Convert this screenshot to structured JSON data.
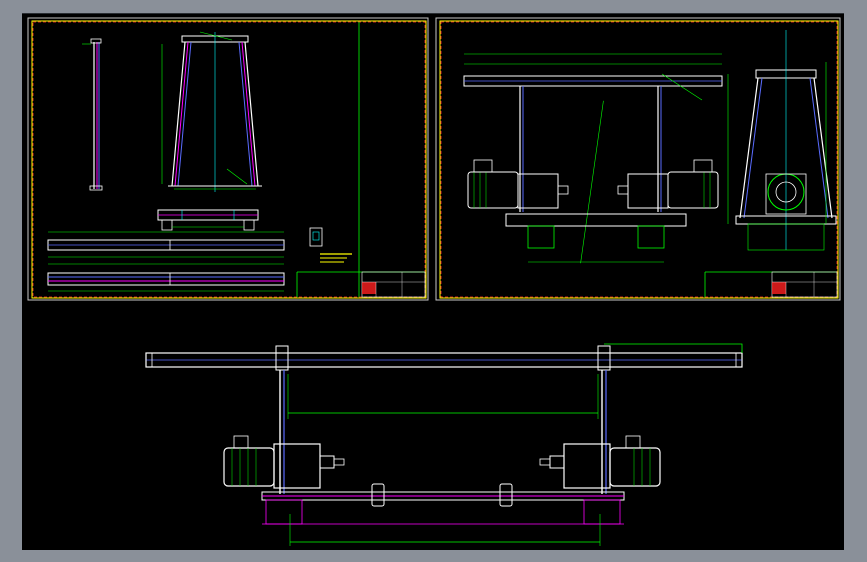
{
  "canvas": {
    "background": "#000000",
    "window_background": "#8a9099"
  },
  "colors": {
    "frame_yellow": "#ffff00",
    "frame_dashed_red": "#ff3030",
    "line_white": "#ffffff",
    "line_green": "#00ff00",
    "line_magenta": "#ff00ff",
    "line_blue": "#5a6cff",
    "line_cyan": "#00ffff",
    "titleblock_red": "#ff2020"
  },
  "sheets": [
    {
      "id": "sheet-1",
      "views": [
        "front-elevation-column",
        "frame-elevation",
        "frame-plan",
        "beam-elevation",
        "beam-plan",
        "detail-bracket"
      ]
    },
    {
      "id": "sheet-2",
      "views": [
        "front-elevation-assembly",
        "side-elevation-assembly"
      ]
    }
  ],
  "titleblock": {
    "sheet1_label": "",
    "sheet2_label": ""
  },
  "main_view": {
    "id": "enlarged-front-elevation",
    "icons": [
      "motor-left-icon",
      "motor-right-icon",
      "gearbox-left-icon",
      "gearbox-right-icon"
    ]
  }
}
